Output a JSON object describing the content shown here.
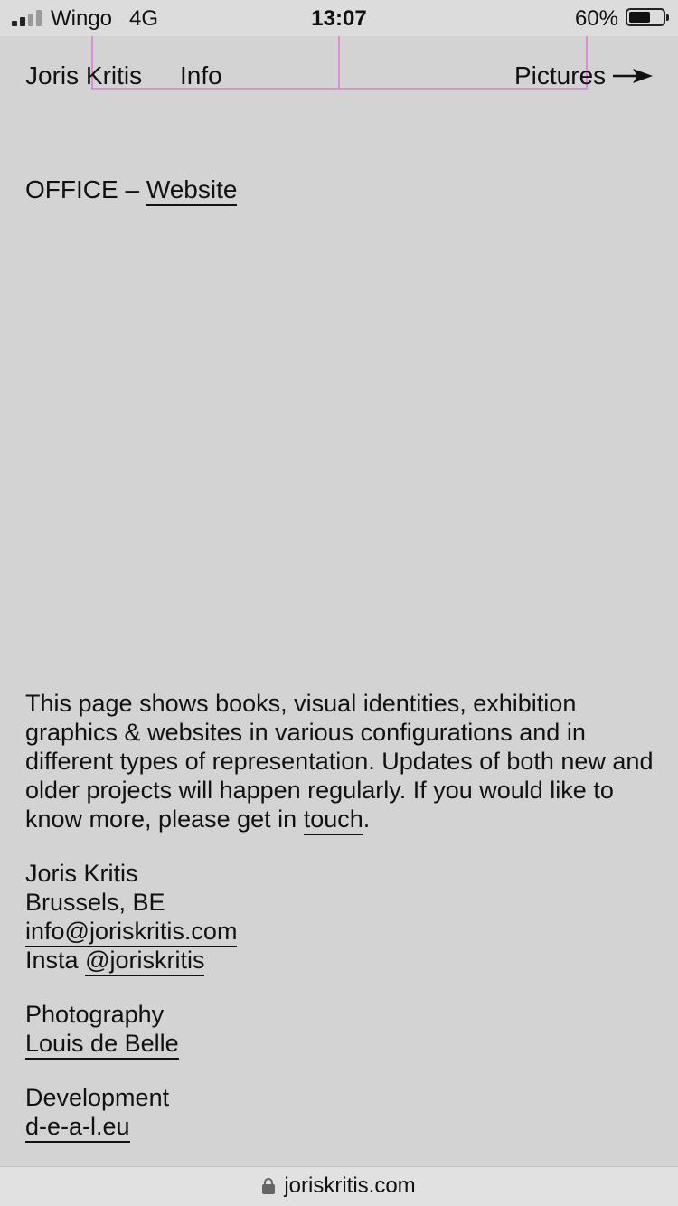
{
  "status_bar": {
    "carrier": "Wingo",
    "network": "4G",
    "time": "13:07",
    "battery_percent": "60%",
    "battery_level": 0.6,
    "signal_bars_active": 2,
    "signal_bars_total": 4
  },
  "nav": {
    "name": "Joris Kritis",
    "info": "Info",
    "pictures": "Pictures",
    "pictures_icon": "arrow-right-icon"
  },
  "project": {
    "client": "OFFICE",
    "separator": "–",
    "type": "Website"
  },
  "about": {
    "text": "This page shows books, visual identities, exhibition graphics & websites in various configurations and in different types of representation. Updates of both new and older projects will happen regularly. If you would like to know more, please get in",
    "link": "touch",
    "end": "."
  },
  "contact": {
    "name": "Joris Kritis",
    "location": "Brussels, BE",
    "email": "info@joriskritis.com",
    "insta_label": "Insta",
    "insta_handle": "@joriskritis"
  },
  "credits": {
    "photography_label": "Photography",
    "photography_name": "Louis de Belle",
    "development_label": "Development",
    "development_name": "d-e-a-l.eu"
  },
  "url_bar": {
    "domain": "joriskritis.com",
    "icon": "lock-icon"
  },
  "colors": {
    "background": "#d3d3d3",
    "guide_lines": "#e28ad8",
    "text": "#111111"
  }
}
